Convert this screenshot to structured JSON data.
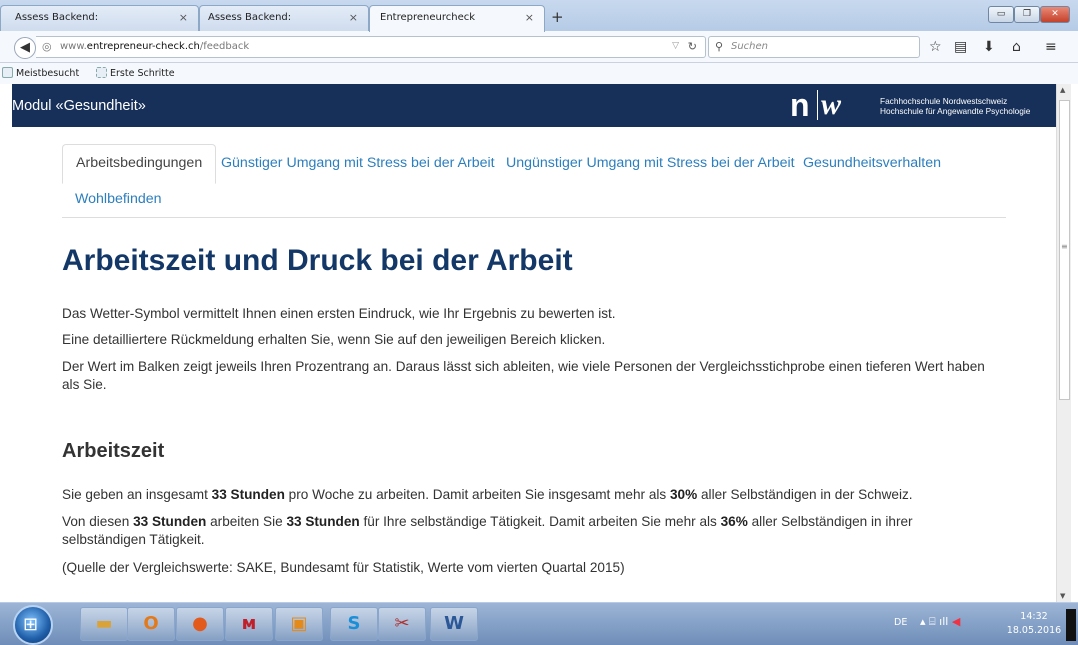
{
  "browser": {
    "tabs": [
      {
        "label": "Assess Backend:",
        "close": "×"
      },
      {
        "label": "Assess Backend:",
        "close": "×"
      },
      {
        "label": "Entrepreneurcheck",
        "close": "×"
      }
    ],
    "new_tab": "+",
    "window_buttons": {
      "minimize": "▭",
      "restore": "❐",
      "close": "✕"
    },
    "url_prefix": "www.",
    "url_domain": "entrepreneur-check.ch",
    "url_path": "/feedback",
    "search_placeholder": "Suchen",
    "bookmarks": [
      "Meistbesucht",
      "Erste Schritte"
    ]
  },
  "site": {
    "module_title": "Modul «Gesundheit»",
    "logo_n": "n",
    "logo_w": "w",
    "institution_line1": "Fachhochschule Nordwestschweiz",
    "institution_line2": "Hochschule für Angewandte Psychologie"
  },
  "content_tabs": [
    "Arbeitsbedingungen",
    "Günstiger Umgang mit Stress bei der Arbeit",
    "Ungünstiger Umgang mit Stress bei der Arbeit",
    "Gesundheitsverhalten",
    "Wohlbefinden"
  ],
  "main": {
    "title": "Arbeitszeit und Druck bei der Arbeit",
    "intro": [
      "Das Wetter-Symbol vermittelt Ihnen einen ersten Eindruck, wie Ihr Ergebnis zu bewerten ist.",
      "Eine detailliertere Rückmeldung erhalten Sie, wenn Sie auf den jeweiligen Bereich klicken.",
      "Der Wert im Balken zeigt jeweils Ihren Prozentrang an. Daraus lässt sich ableiten, wie viele Personen der Vergleichsstichprobe einen tieferen Wert haben als Sie."
    ],
    "section_title": "Arbeitszeit",
    "s1": {
      "a": "Sie geben an insgesamt ",
      "b": "33 Stunden",
      "c": " pro Woche zu arbeiten. Damit arbeiten Sie insgesamt mehr als ",
      "d": "30%",
      "e": " aller Selbständigen in der Schweiz."
    },
    "s2": {
      "a": "Von diesen ",
      "b": "33 Stunden",
      "c": " arbeiten Sie ",
      "d": "33 Stunden",
      "e": " für Ihre selbständige Tätigkeit. Damit arbeiten Sie mehr als ",
      "f": "36%",
      "g": " aller Selbständigen in ihrer selbständigen Tätigkeit."
    },
    "source": "(Quelle der Vergleichswerte: SAKE, Bundesamt für Statistik, Werte vom vierten Quartal 2015)"
  },
  "taskbar": {
    "language": "DE",
    "time": "14:32",
    "date": "18.05.2016"
  }
}
